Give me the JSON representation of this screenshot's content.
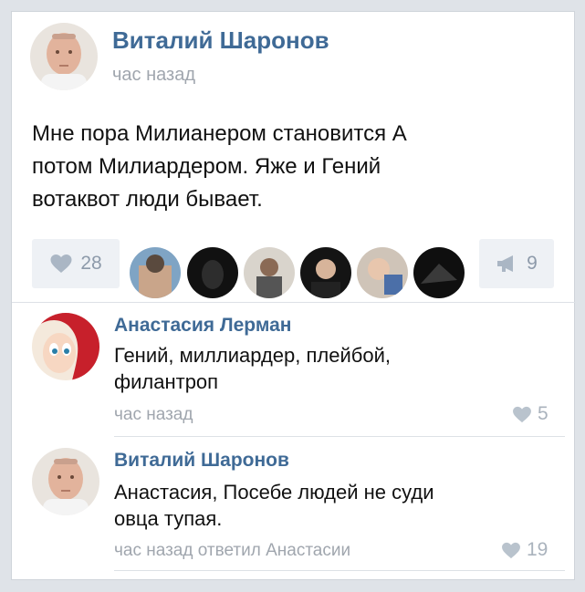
{
  "post": {
    "author": "Виталий Шаронов",
    "time": "час назад",
    "text_lines": [
      "Мне пора Милианером становится А",
      "потом Милиардером. Яже и Гений",
      "вотаквот люди бывает."
    ],
    "likes": "28",
    "shares": "9"
  },
  "comments": [
    {
      "author": "Анастасия Лерман",
      "text_lines": [
        "Гений, миллиардер, плейбой,",
        "филантроп"
      ],
      "time": "час назад",
      "likes": "5"
    },
    {
      "author": "Виталий Шаронов",
      "text_lines": [
        "Анастасия, Посебе людей не суди",
        "овца тупая."
      ],
      "time": "час назад ответил Анастасии",
      "likes": "19"
    }
  ],
  "colors": {
    "name": "#3f6a96",
    "meta": "#a0a6ae",
    "pill_bg": "#eef1f5"
  },
  "icons": [
    "heart-icon",
    "megaphone-icon"
  ]
}
